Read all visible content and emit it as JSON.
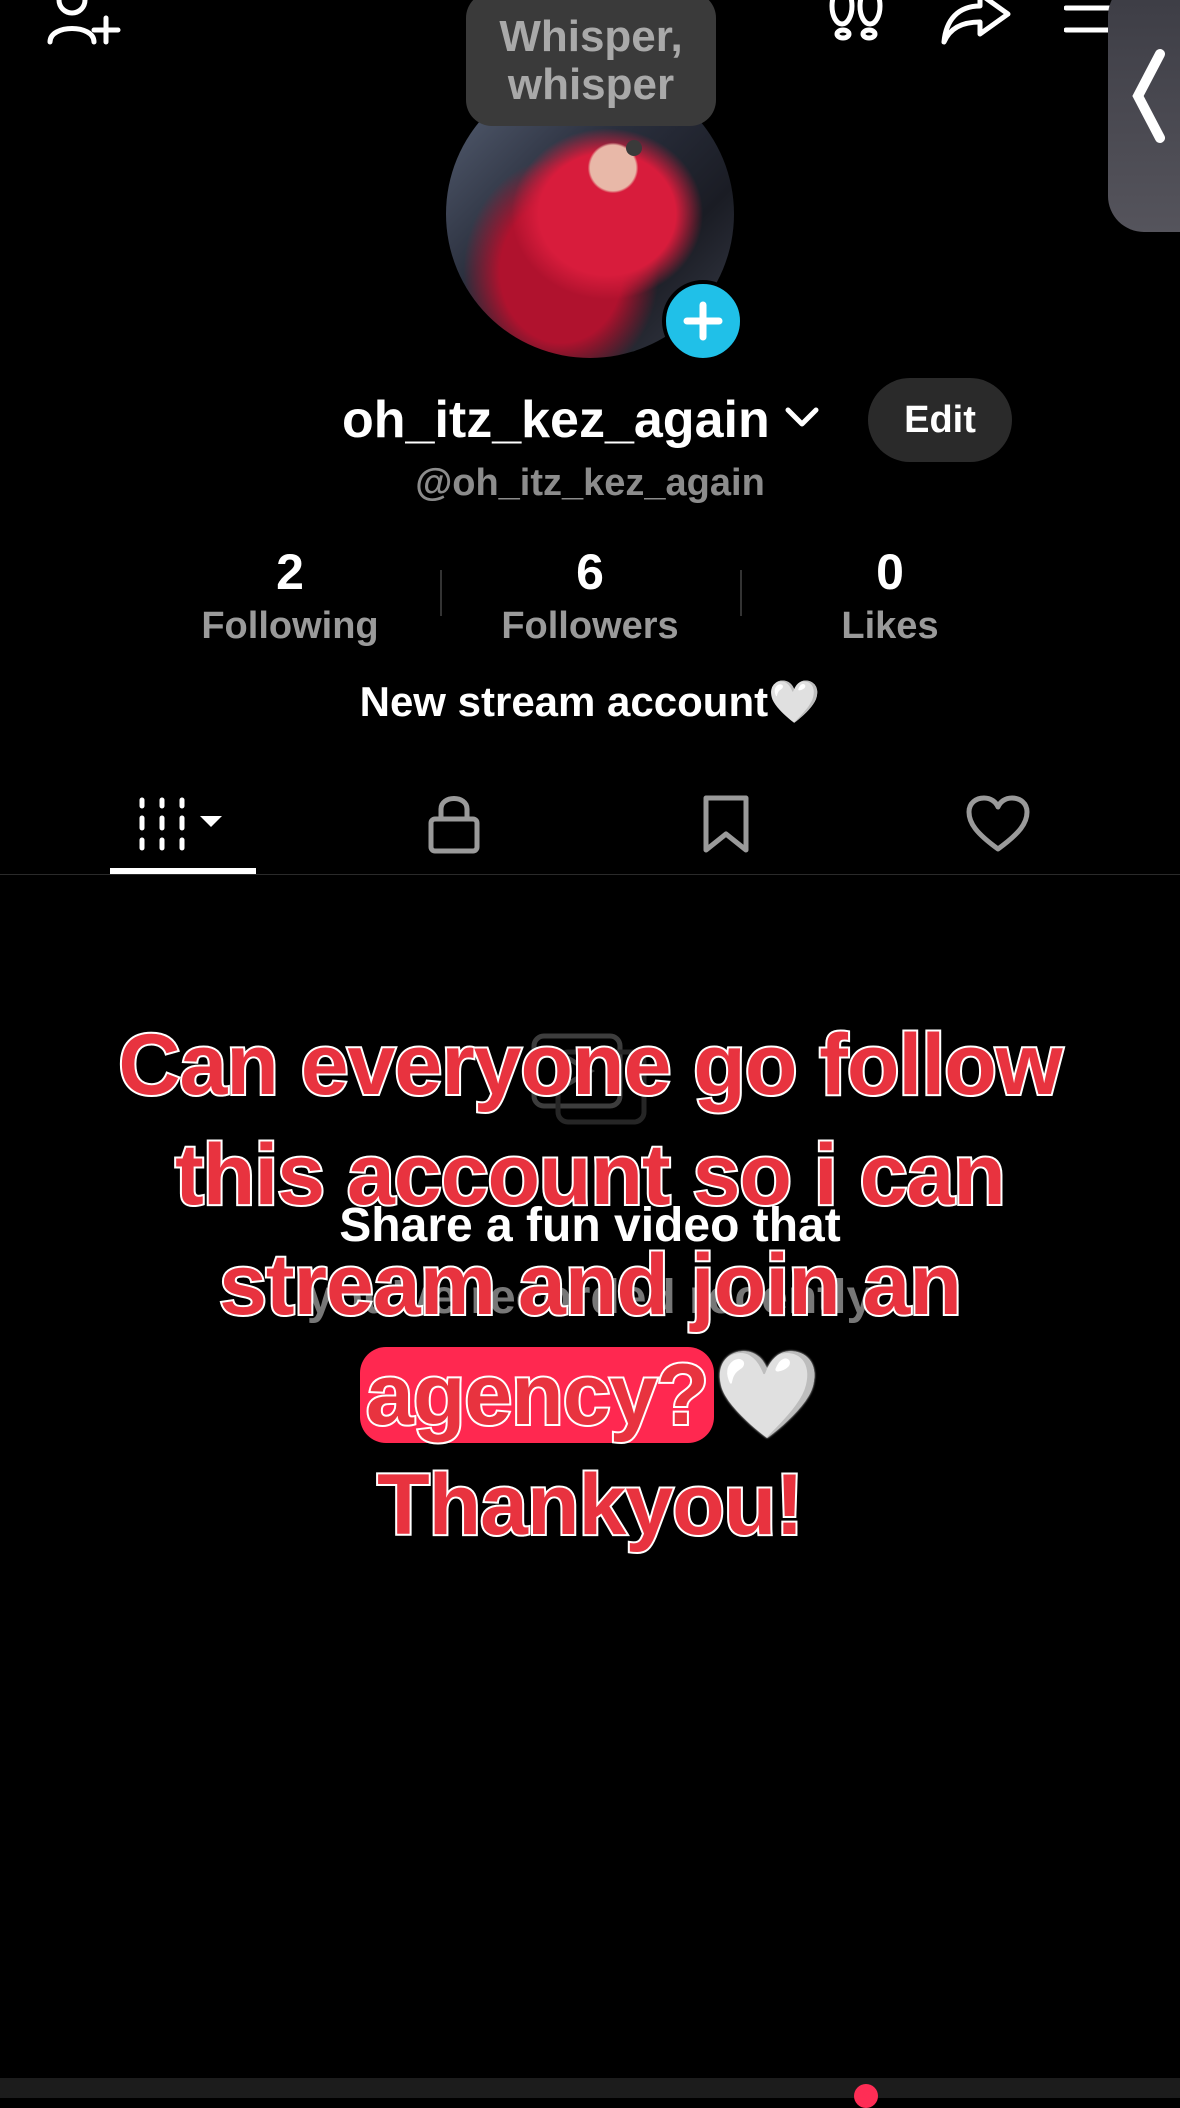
{
  "tooltip": {
    "text_line1": "Whisper,",
    "text_line2": "whisper"
  },
  "profile": {
    "username": "oh_itz_kez_again",
    "handle": "@oh_itz_kez_again",
    "edit_label": "Edit",
    "bio": "New stream account🤍"
  },
  "stats": {
    "following": {
      "value": "2",
      "label": "Following"
    },
    "followers": {
      "value": "6",
      "label": "Followers"
    },
    "likes": {
      "value": "0",
      "label": "Likes"
    }
  },
  "empty_state": {
    "line1": "Share a fun video that",
    "line2": "you've recorded recently"
  },
  "overlay": {
    "line1": "Can everyone go follow",
    "line2": "this account so i can",
    "line3": "stream and join an",
    "line4_a": "agency?",
    "line4_b": "🤍",
    "line5": "Thankyou!"
  },
  "icons": {
    "top_left": "add-friend-icon",
    "top_right": [
      "footprints-icon",
      "share-icon",
      "menu-icon"
    ],
    "tabs": [
      "grid-icon",
      "lock-icon",
      "bookmark-icon",
      "heart-icon"
    ]
  },
  "colors": {
    "background": "#000000",
    "accent_cyan": "#20c0e8",
    "overlay_red": "#e8333f",
    "highlight_pink": "#ff2850"
  }
}
